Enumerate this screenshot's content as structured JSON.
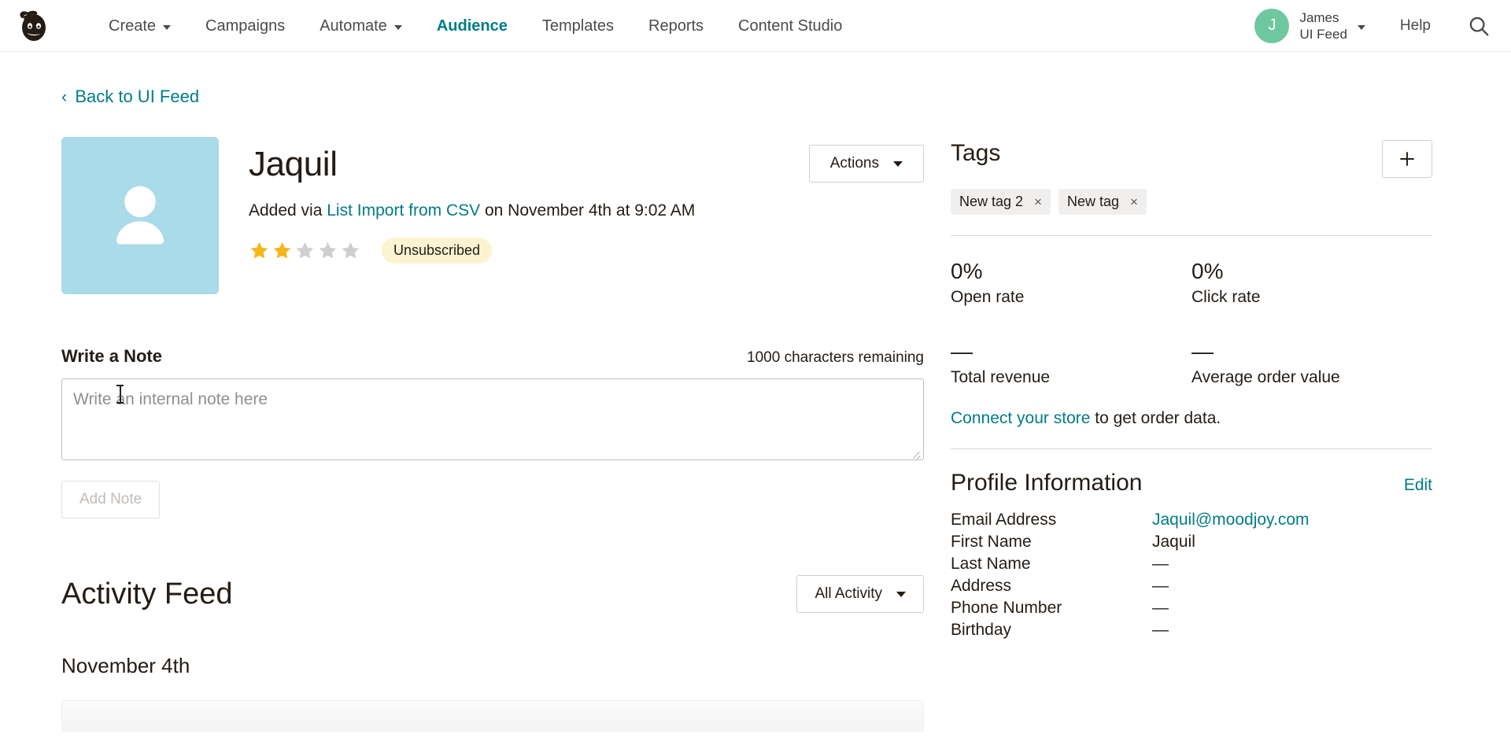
{
  "header": {
    "logo_icon": "mailchimp-freddie-logo",
    "nav": [
      {
        "label": "Create",
        "has_caret": true,
        "active": false
      },
      {
        "label": "Campaigns",
        "has_caret": false,
        "active": false
      },
      {
        "label": "Automate",
        "has_caret": true,
        "active": false
      },
      {
        "label": "Audience",
        "has_caret": false,
        "active": true
      },
      {
        "label": "Templates",
        "has_caret": false,
        "active": false
      },
      {
        "label": "Reports",
        "has_caret": false,
        "active": false
      },
      {
        "label": "Content Studio",
        "has_caret": false,
        "active": false
      }
    ],
    "account": {
      "avatar_initial": "J",
      "avatar_color": "#6dc8a0",
      "name": "James",
      "org": "UI Feed"
    },
    "help_label": "Help",
    "search_icon": "search-icon",
    "accent_color": "#007c89"
  },
  "back_link": {
    "label": "Back to UI Feed",
    "icon": "chevron-left-icon"
  },
  "contact": {
    "placeholder_icon": "person-avatar-icon",
    "placeholder_bg": "#a9dbe8",
    "name": "Jaquil",
    "added_prefix": "Added via ",
    "added_source": "List Import from CSV",
    "added_suffix": " on November 4th at 9:02 AM",
    "rating": 2,
    "rating_max": 5,
    "star_filled_color": "#f4b619",
    "star_empty_color": "#cfcfcf",
    "status_badge": "Unsubscribed",
    "actions_button": "Actions"
  },
  "note": {
    "title": "Write a Note",
    "chars_remaining": "1000 characters remaining",
    "placeholder": "Write an internal note here",
    "value": "",
    "add_button": "Add Note",
    "add_button_disabled": true
  },
  "activity_feed": {
    "title": "Activity Feed",
    "filter_label": "All Activity",
    "date_group": "November 4th"
  },
  "tags": {
    "title": "Tags",
    "add_icon": "plus-icon",
    "items": [
      {
        "label": "New tag 2",
        "remove_icon": "close-icon"
      },
      {
        "label": "New tag",
        "remove_icon": "close-icon"
      }
    ]
  },
  "stats": [
    {
      "value": "0%",
      "label": "Open rate"
    },
    {
      "value": "0%",
      "label": "Click rate"
    },
    {
      "value": "—",
      "label": "Total revenue"
    },
    {
      "value": "—",
      "label": "Average order value"
    }
  ],
  "connect_store": {
    "link": "Connect your store",
    "rest": " to get order data."
  },
  "profile_information": {
    "title": "Profile Information",
    "edit_label": "Edit",
    "rows": [
      {
        "key": "Email Address",
        "value": "Jaquil@moodjoy.com",
        "is_link": true
      },
      {
        "key": "First Name",
        "value": "Jaquil",
        "is_link": false
      },
      {
        "key": "Last Name",
        "value": "—",
        "is_link": false
      },
      {
        "key": "Address",
        "value": "—",
        "is_link": false
      },
      {
        "key": "Phone Number",
        "value": "—",
        "is_link": false
      },
      {
        "key": "Birthday",
        "value": "—",
        "is_link": false
      }
    ]
  }
}
